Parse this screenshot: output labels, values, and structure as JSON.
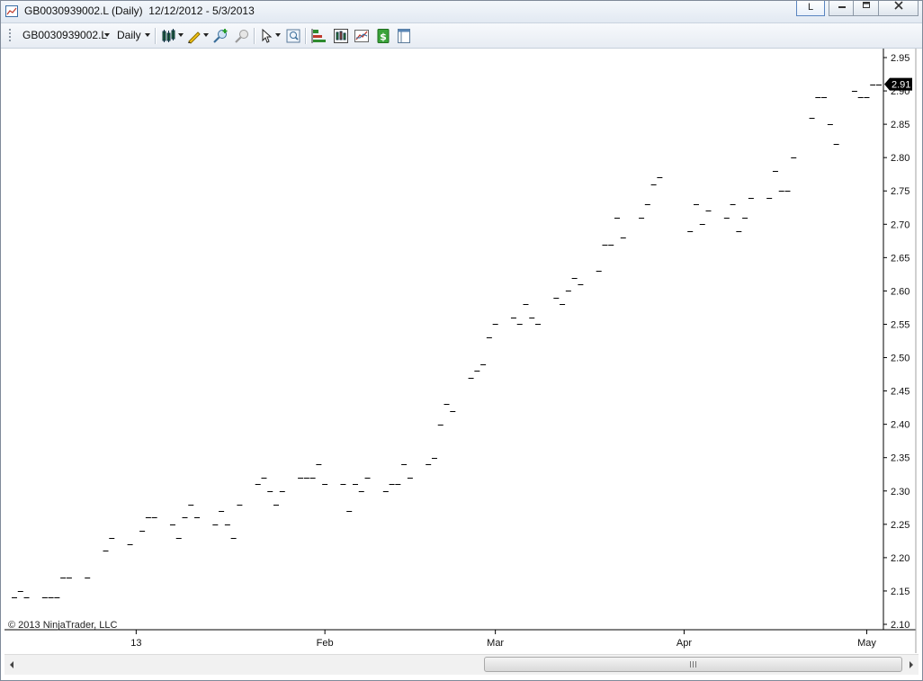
{
  "window": {
    "title": "GB0030939002.L (Daily)  12/12/2012 - 5/3/2013",
    "link_button": "L"
  },
  "toolbar": {
    "instrument": "GB0030939002.L",
    "period": "Daily",
    "icons": [
      "bar-type-icon",
      "drawing-tools-icon",
      "zoom-in-icon",
      "zoom-out-icon",
      "pointer-icon",
      "data-box-icon",
      "indicators-icon",
      "strategies-icon",
      "chart-style-icon",
      "currency-icon",
      "properties-icon"
    ]
  },
  "chart_data": {
    "type": "scatter",
    "style": "dash markers",
    "x_type": "date",
    "x": [
      "2012-12-12",
      "2012-12-13",
      "2012-12-14",
      "2012-12-17",
      "2012-12-18",
      "2012-12-19",
      "2012-12-20",
      "2012-12-21",
      "2012-12-24",
      "2012-12-27",
      "2012-12-28",
      "2012-12-31",
      "2013-01-02",
      "2013-01-03",
      "2013-01-04",
      "2013-01-07",
      "2013-01-08",
      "2013-01-09",
      "2013-01-10",
      "2013-01-11",
      "2013-01-14",
      "2013-01-15",
      "2013-01-16",
      "2013-01-17",
      "2013-01-18",
      "2013-01-21",
      "2013-01-22",
      "2013-01-23",
      "2013-01-24",
      "2013-01-25",
      "2013-01-28",
      "2013-01-29",
      "2013-01-30",
      "2013-01-31",
      "2013-02-01",
      "2013-02-04",
      "2013-02-05",
      "2013-02-06",
      "2013-02-07",
      "2013-02-08",
      "2013-02-11",
      "2013-02-12",
      "2013-02-13",
      "2013-02-14",
      "2013-02-15",
      "2013-02-18",
      "2013-02-19",
      "2013-02-20",
      "2013-02-21",
      "2013-02-22",
      "2013-02-25",
      "2013-02-26",
      "2013-02-27",
      "2013-02-28",
      "2013-03-01",
      "2013-03-04",
      "2013-03-05",
      "2013-03-06",
      "2013-03-07",
      "2013-03-08",
      "2013-03-11",
      "2013-03-12",
      "2013-03-13",
      "2013-03-14",
      "2013-03-15",
      "2013-03-18",
      "2013-03-19",
      "2013-03-20",
      "2013-03-21",
      "2013-03-22",
      "2013-03-25",
      "2013-03-26",
      "2013-03-27",
      "2013-03-28",
      "2013-04-02",
      "2013-04-03",
      "2013-04-04",
      "2013-04-05",
      "2013-04-08",
      "2013-04-09",
      "2013-04-10",
      "2013-04-11",
      "2013-04-12",
      "2013-04-15",
      "2013-04-16",
      "2013-04-17",
      "2013-04-18",
      "2013-04-19",
      "2013-04-22",
      "2013-04-23",
      "2013-04-24",
      "2013-04-25",
      "2013-04-26",
      "2013-04-29",
      "2013-04-30",
      "2013-05-01",
      "2013-05-02",
      "2013-05-03"
    ],
    "y": [
      2.14,
      2.15,
      2.14,
      2.14,
      2.14,
      2.14,
      2.17,
      2.17,
      2.17,
      2.21,
      2.23,
      2.22,
      2.24,
      2.26,
      2.26,
      2.25,
      2.23,
      2.26,
      2.28,
      2.26,
      2.25,
      2.27,
      2.25,
      2.23,
      2.28,
      2.31,
      2.32,
      2.3,
      2.28,
      2.3,
      2.32,
      2.32,
      2.32,
      2.34,
      2.31,
      2.31,
      2.27,
      2.31,
      2.3,
      2.32,
      2.3,
      2.31,
      2.31,
      2.34,
      2.32,
      2.34,
      2.35,
      2.4,
      2.43,
      2.42,
      2.47,
      2.48,
      2.49,
      2.53,
      2.55,
      2.56,
      2.55,
      2.58,
      2.56,
      2.55,
      2.59,
      2.58,
      2.6,
      2.62,
      2.61,
      2.63,
      2.67,
      2.67,
      2.71,
      2.68,
      2.71,
      2.73,
      2.76,
      2.77,
      2.69,
      2.73,
      2.7,
      2.72,
      2.71,
      2.73,
      2.69,
      2.71,
      2.74,
      2.74,
      2.78,
      2.75,
      2.75,
      2.8,
      2.86,
      2.89,
      2.89,
      2.85,
      2.82,
      2.9,
      2.89,
      2.89,
      2.91,
      2.91
    ],
    "xtick_labels": [
      "13",
      "Feb",
      "Mar",
      "Apr",
      "May"
    ],
    "xtick_dates": [
      "2013-01-01",
      "2013-02-01",
      "2013-03-01",
      "2013-04-01",
      "2013-05-01"
    ],
    "ylim": [
      2.1,
      2.95
    ],
    "yticks": [
      "2.95",
      "2.90",
      "2.85",
      "2.80",
      "2.75",
      "2.70",
      "2.65",
      "2.60",
      "2.55",
      "2.50",
      "2.45",
      "2.40",
      "2.35",
      "2.30",
      "2.25",
      "2.20",
      "2.15",
      "2.10"
    ],
    "last_price_label": "2.91",
    "grid": false,
    "copyright": "© 2013 NinjaTrader, LLC",
    "colors": {
      "marker": "#000000",
      "label_bg": "#000000",
      "label_text": "#ffffff"
    }
  }
}
